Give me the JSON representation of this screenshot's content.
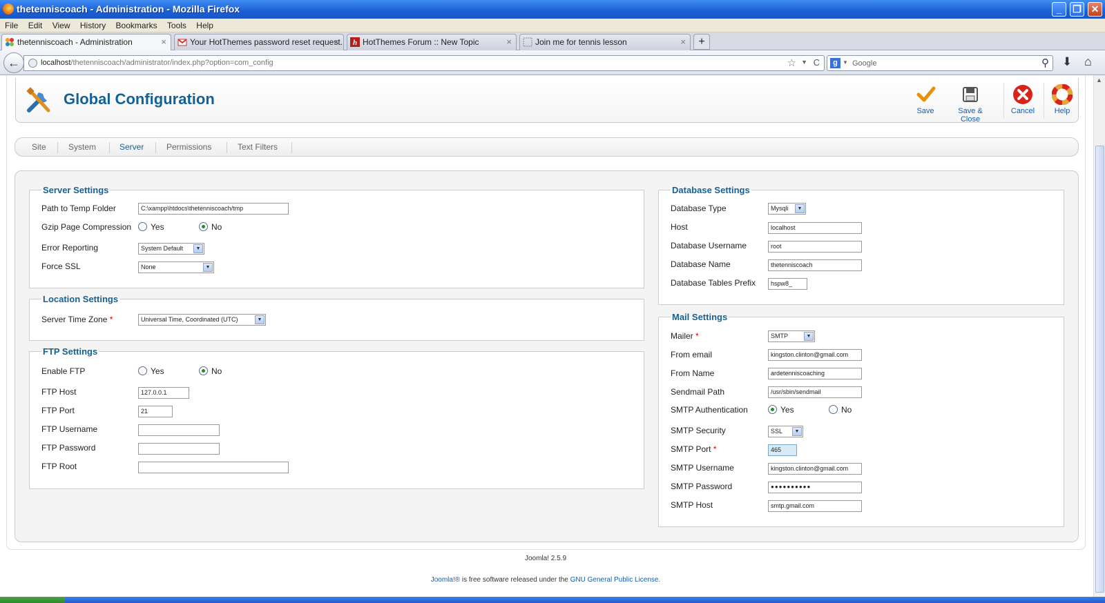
{
  "window": {
    "title": "thetenniscoach - Administration - Mozilla Firefox",
    "minimize": "_",
    "maximize": "❐",
    "close": "✕"
  },
  "menu": [
    "File",
    "Edit",
    "View",
    "History",
    "Bookmarks",
    "Tools",
    "Help"
  ],
  "tabs": [
    {
      "title": "thetenniscoach - Administration",
      "close": "×"
    },
    {
      "title": "Your HotThemes password reset request...",
      "close": "×"
    },
    {
      "title": "HotThemes Forum :: New Topic",
      "close": "×"
    },
    {
      "title": "Join me for tennis lesson",
      "close": "×"
    }
  ],
  "new_tab": "+",
  "nav": {
    "back": "←",
    "url_host": "localhost",
    "url_path": "/thetenniscoach/administrator/index.php?option=com_config",
    "bookmark_star": "☆",
    "history_dropdown": "▼",
    "reload": "C",
    "search_engine": "g",
    "search_dropdown": "▼",
    "search_placeholder": "Google",
    "search_go": "⚲",
    "downloads": "⬇",
    "home": "⌂"
  },
  "header": {
    "title": "Global Configuration"
  },
  "toolbar": {
    "save": "Save",
    "save_close": "Save & Close",
    "cancel": "Cancel",
    "help": "Help"
  },
  "subtabs": [
    "Site",
    "System",
    "Server",
    "Permissions",
    "Text Filters"
  ],
  "active_subtab": "Server",
  "server_settings": {
    "legend": "Server Settings",
    "temp_path_label": "Path to Temp Folder",
    "temp_path_value": "C:\\xampp\\htdocs\\thetenniscoach/tmp",
    "gzip_label": "Gzip Page Compression",
    "gzip_yes": "Yes",
    "gzip_no": "No",
    "gzip_selected": "No",
    "error_label": "Error Reporting",
    "error_value": "System Default",
    "ssl_label": "Force SSL",
    "ssl_value": "None"
  },
  "location_settings": {
    "legend": "Location Settings",
    "timezone_label": "Server Time Zone",
    "timezone_req": "*",
    "timezone_value": "Universal Time, Coordinated (UTC)"
  },
  "ftp_settings": {
    "legend": "FTP Settings",
    "enable_label": "Enable FTP",
    "enable_yes": "Yes",
    "enable_no": "No",
    "enable_selected": "No",
    "host_label": "FTP Host",
    "host_value": "127.0.0.1",
    "port_label": "FTP Port",
    "port_value": "21",
    "username_label": "FTP Username",
    "username_value": "",
    "password_label": "FTP Password",
    "password_value": "",
    "root_label": "FTP Root",
    "root_value": ""
  },
  "database_settings": {
    "legend": "Database Settings",
    "type_label": "Database Type",
    "type_value": "Mysqli",
    "host_label": "Host",
    "host_value": "localhost",
    "username_label": "Database Username",
    "username_value": "root",
    "name_label": "Database Name",
    "name_value": "thetenniscoach",
    "prefix_label": "Database Tables Prefix",
    "prefix_value": "hspw8_"
  },
  "mail_settings": {
    "legend": "Mail Settings",
    "mailer_label": "Mailer",
    "mailer_req": "*",
    "mailer_value": "SMTP",
    "from_email_label": "From email",
    "from_email_value": "kingston.clinton@gmail.com",
    "from_name_label": "From Name",
    "from_name_value": "ardetenniscoaching",
    "sendmail_label": "Sendmail Path",
    "sendmail_value": "/usr/sbin/sendmail",
    "smtp_auth_label": "SMTP Authentication",
    "smtp_auth_yes": "Yes",
    "smtp_auth_no": "No",
    "smtp_auth_selected": "Yes",
    "smtp_security_label": "SMTP Security",
    "smtp_security_value": "SSL",
    "smtp_port_label": "SMTP Port",
    "smtp_port_req": "*",
    "smtp_port_value": "465",
    "smtp_user_label": "SMTP Username",
    "smtp_user_value": "kingston.clinton@gmail.com",
    "smtp_pass_label": "SMTP Password",
    "smtp_pass_value": "●●●●●●●●●●",
    "smtp_host_label": "SMTP Host",
    "smtp_host_value": "smtp.gmail.com"
  },
  "footer": {
    "version": "Joomla! 2.5.9",
    "license_link1": "Joomla!®",
    "license_text": " is free software released under the ",
    "license_link2": "GNU General Public License",
    "license_end": "."
  },
  "colors": {
    "accent": "#146295",
    "titlebar": "#1b5fd6",
    "link": "#135cae"
  }
}
